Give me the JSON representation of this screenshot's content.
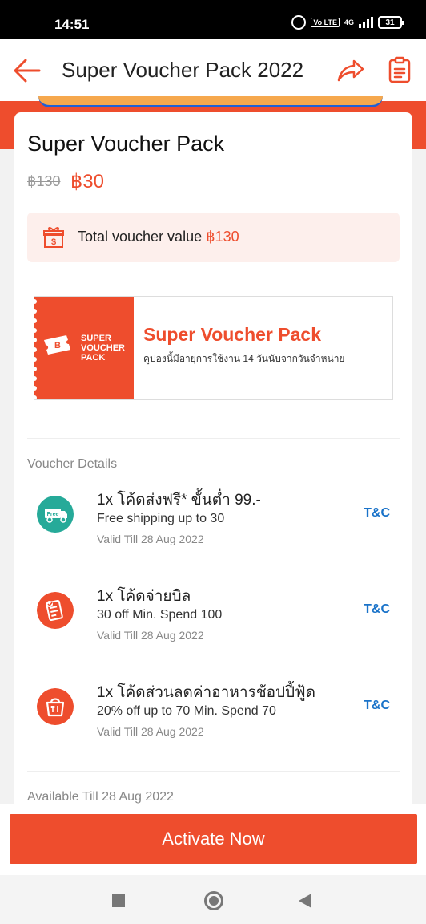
{
  "status_bar": {
    "time": "14:51",
    "volte": "Vo LTE",
    "network": "4G",
    "battery": "31"
  },
  "header": {
    "title": "Super Voucher Pack 2022"
  },
  "pack": {
    "name": "Super Voucher Pack",
    "original_price": "฿130",
    "price": "฿30",
    "total_label": "Total voucher value",
    "total_value": "฿130"
  },
  "promo_banner": {
    "brand_line1": "SUPER",
    "brand_line2": "VOUCHER",
    "brand_line3": "PACK",
    "ticket_letter": "B",
    "title": "Super Voucher Pack",
    "subtitle": "คูปองนี้มีอายุการใช้งาน 14 วันนับจากวันจำหน่าย"
  },
  "voucher_details_label": "Voucher Details",
  "vouchers": [
    {
      "title": "1x โค้ดส่งฟรี* ขั้นต่ำ 99.-",
      "description": "Free shipping up to 30",
      "valid": "Valid Till 28 Aug 2022",
      "tnc": "T&C",
      "icon": "free-shipping-truck-icon",
      "icon_color": "#26aa99",
      "icon_badge": "Free"
    },
    {
      "title": "1x โค้ดจ่ายบิล",
      "description": "30 off Min. Spend 100",
      "valid": "Valid Till 28 Aug 2022",
      "tnc": "T&C",
      "icon": "bill-payment-icon",
      "icon_color": "#ee4d2d"
    },
    {
      "title": "1x โค้ดส่วนลดค่าอาหารช้อปปี้ฟู้ด",
      "description": "20% off up to 70 Min. Spend 70",
      "valid": "Valid Till 28 Aug 2022",
      "tnc": "T&C",
      "icon": "food-delivery-icon",
      "icon_color": "#ee4d2d"
    }
  ],
  "available_till": "Available Till 28 Aug 2022",
  "activate_button": "Activate Now",
  "colors": {
    "accent": "#ee4d2d",
    "link": "#1a73c9",
    "teal": "#26aa99"
  }
}
